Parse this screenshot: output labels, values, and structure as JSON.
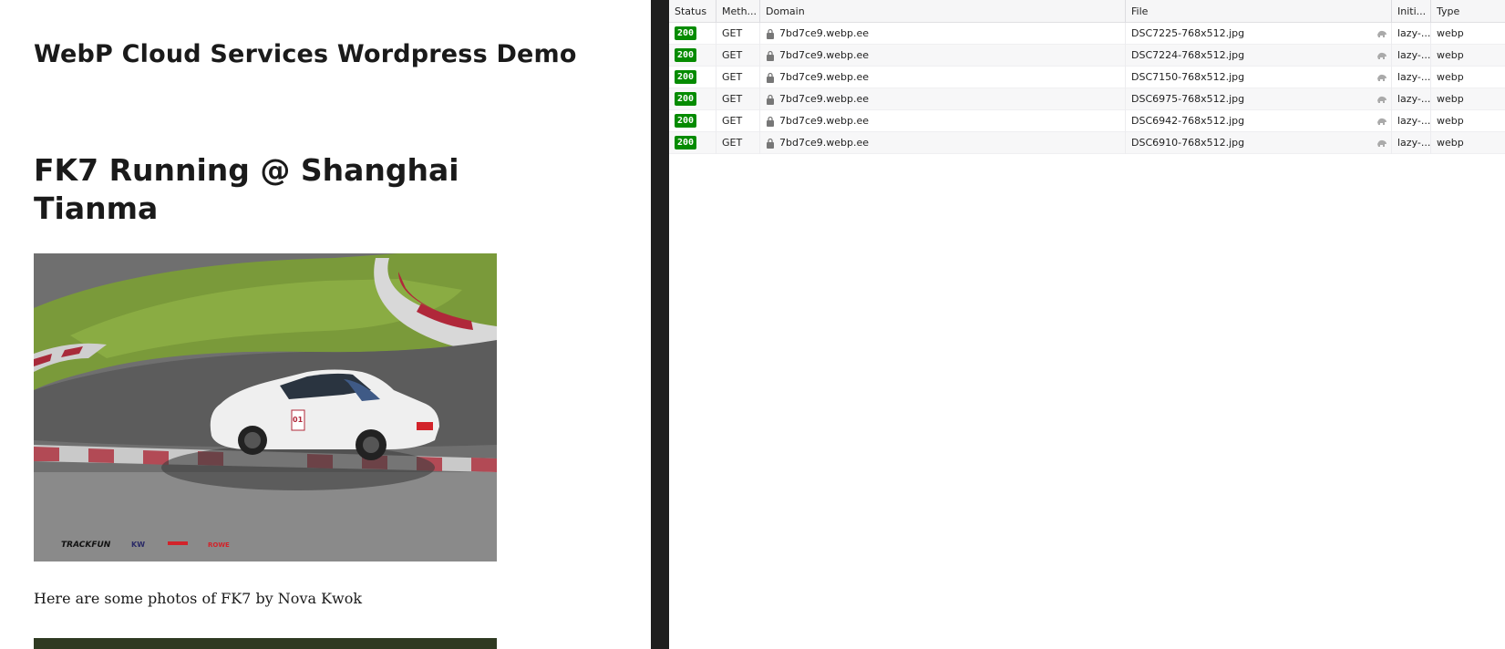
{
  "site": {
    "title": "WebP Cloud Services Wordpress Demo"
  },
  "post": {
    "title": "FK7 Running @ Shanghai Tianma",
    "caption": "Here are some photos of FK7 by Nova Kwok",
    "photo_logos": [
      "TRACKFUN",
      "KW",
      "ROWE"
    ],
    "car_number": "01"
  },
  "network": {
    "columns": {
      "status": "Status",
      "method": "Meth...",
      "domain": "Domain",
      "file": "File",
      "initiator": "Initi...",
      "type": "Type"
    },
    "rows": [
      {
        "status": "200",
        "method": "GET",
        "domain": "7bd7ce9.webp.ee",
        "file": "DSC7225-768x512.jpg",
        "initiator": "lazy-...",
        "type": "webp"
      },
      {
        "status": "200",
        "method": "GET",
        "domain": "7bd7ce9.webp.ee",
        "file": "DSC7224-768x512.jpg",
        "initiator": "lazy-...",
        "type": "webp"
      },
      {
        "status": "200",
        "method": "GET",
        "domain": "7bd7ce9.webp.ee",
        "file": "DSC7150-768x512.jpg",
        "initiator": "lazy-...",
        "type": "webp"
      },
      {
        "status": "200",
        "method": "GET",
        "domain": "7bd7ce9.webp.ee",
        "file": "DSC6975-768x512.jpg",
        "initiator": "lazy-...",
        "type": "webp"
      },
      {
        "status": "200",
        "method": "GET",
        "domain": "7bd7ce9.webp.ee",
        "file": "DSC6942-768x512.jpg",
        "initiator": "lazy-...",
        "type": "webp"
      },
      {
        "status": "200",
        "method": "GET",
        "domain": "7bd7ce9.webp.ee",
        "file": "DSC6910-768x512.jpg",
        "initiator": "lazy-...",
        "type": "webp"
      }
    ],
    "icons": {
      "secure": "lock-icon",
      "tracker": "tracker-icon"
    },
    "colors": {
      "status_ok": "#058b00"
    }
  }
}
